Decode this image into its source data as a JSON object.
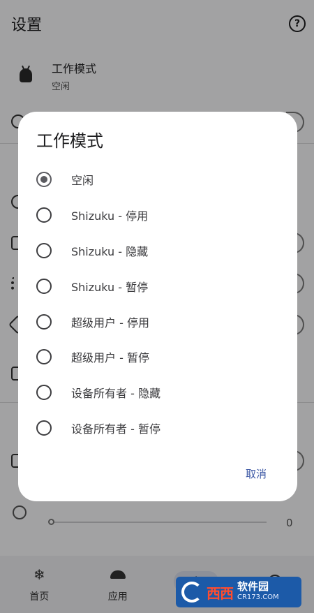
{
  "appbar": {
    "title": "设置",
    "help_icon": "help-circle-icon",
    "help_glyph": "?"
  },
  "pref": {
    "title": "工作模式",
    "summary": "空闲",
    "icon": "android-icon"
  },
  "slider": {
    "value": "0"
  },
  "bottom_nav": {
    "items": [
      {
        "label": "首页",
        "icon": "snowflake-icon",
        "glyph": "❄"
      },
      {
        "label": "应用",
        "icon": "android-icon"
      },
      {
        "label": "",
        "icon": "settings-icon",
        "glyph": "⚙",
        "active": true
      },
      {
        "label": "",
        "icon": "info-icon",
        "glyph": "i"
      }
    ]
  },
  "dialog": {
    "title": "工作模式",
    "options": [
      {
        "label": "空闲",
        "selected": true
      },
      {
        "label": "Shizuku - 停用",
        "selected": false
      },
      {
        "label": "Shizuku - 隐藏",
        "selected": false
      },
      {
        "label": "Shizuku - 暂停",
        "selected": false
      },
      {
        "label": "超级用户 - 停用",
        "selected": false
      },
      {
        "label": "超级用户 - 暂停",
        "selected": false
      },
      {
        "label": "设备所有者 - 隐藏",
        "selected": false
      },
      {
        "label": "设备所有者 - 暂停",
        "selected": false
      }
    ],
    "cancel_label": "取消"
  },
  "watermark": {
    "red": "西西",
    "white": "软件园",
    "sub": "CR173.COM"
  },
  "colors": {
    "accent": "#3f5aa6",
    "scrim": "rgba(0,0,0,0.34)",
    "nav_active": "#d7dbe8"
  }
}
